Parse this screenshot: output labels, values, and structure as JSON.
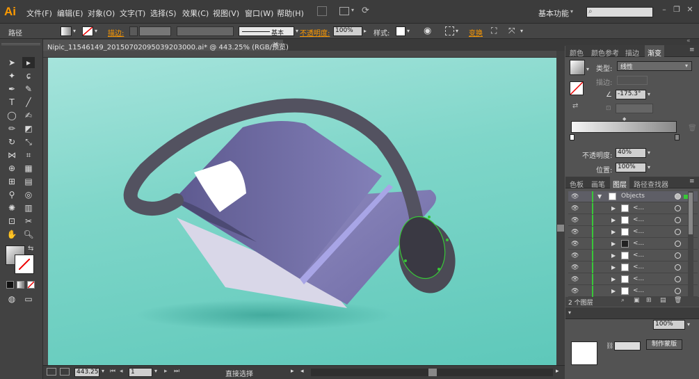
{
  "app": {
    "logo": "Ai"
  },
  "menu": [
    "文件(F)",
    "编辑(E)",
    "对象(O)",
    "文字(T)",
    "选择(S)",
    "效果(C)",
    "视图(V)",
    "窗口(W)",
    "帮助(H)"
  ],
  "workspace": "基本功能",
  "control_bar": {
    "mode": "路径",
    "stroke_label": "描边:",
    "stroke_style": "基本",
    "opacity_label": "不透明度:",
    "opacity_value": "100%",
    "style_label": "样式:",
    "transform": "变换"
  },
  "document": {
    "tab": "Nipic_11546149_20150702095039203000.ai* @ 443.25% (RGB/预览)"
  },
  "status": {
    "zoom": "443.25",
    "artboard": "1",
    "tool": "直接选择"
  },
  "gradient_panel": {
    "tabs": [
      "颜色",
      "颜色参考",
      "描边",
      "渐变"
    ],
    "type_label": "类型:",
    "type_value": "线性",
    "stroke_label": "描边:",
    "angle": "-175.3°",
    "opacity_label": "不透明度:",
    "opacity_value": "40%",
    "location_label": "位置:",
    "location_value": "100%"
  },
  "layers_panel": {
    "tabs": [
      "色板",
      "画笔",
      "图层",
      "路径查找器"
    ],
    "layer_name": "Objects",
    "sublayer": "<...",
    "count": "2 个图层"
  },
  "bottom_panel": {
    "opacity_value": "100%",
    "mask_button": "制作蒙版"
  },
  "colors": {
    "accent": "#ff9a00",
    "artboard": "#7fd6c9",
    "cuff": "#6e6aa0",
    "selection": "#38c738"
  }
}
